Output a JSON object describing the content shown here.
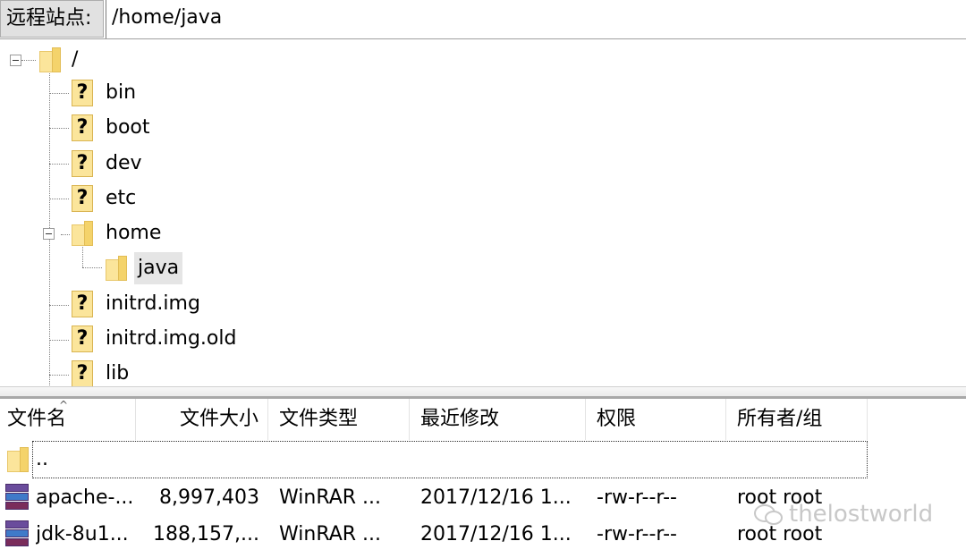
{
  "address_bar": {
    "label": "远程站点:",
    "path": "/home/java"
  },
  "tree": {
    "root": "/",
    "items": [
      {
        "name": "bin",
        "icon": "unknown-folder-icon"
      },
      {
        "name": "boot",
        "icon": "unknown-folder-icon"
      },
      {
        "name": "dev",
        "icon": "unknown-folder-icon"
      },
      {
        "name": "etc",
        "icon": "unknown-folder-icon"
      },
      {
        "name": "home",
        "icon": "folder-icon",
        "expanded": true
      },
      {
        "name": "java",
        "icon": "folder-icon",
        "selected": true
      },
      {
        "name": "initrd.img",
        "icon": "unknown-folder-icon"
      },
      {
        "name": "initrd.img.old",
        "icon": "unknown-folder-icon"
      },
      {
        "name": "lib",
        "icon": "unknown-folder-icon"
      }
    ],
    "unknown_glyph": "?"
  },
  "file_list": {
    "columns": [
      "文件名",
      "文件大小",
      "文件类型",
      "最近修改",
      "权限",
      "所有者/组"
    ],
    "sort_indicator": "^",
    "parent_row": "..",
    "rows": [
      {
        "name": "apache-...",
        "size": "8,997,403",
        "type": "WinRAR ...",
        "modified": "2017/12/16 1...",
        "perms": "-rw-r--r--",
        "owner": "root root"
      },
      {
        "name": "jdk-8u1...",
        "size": "188,157,...",
        "type": "WinRAR ...",
        "modified": "2017/12/16 1...",
        "perms": "-rw-r--r--",
        "owner": "root root"
      }
    ]
  },
  "watermark": "thelostworld",
  "colors": {
    "folder": "#fbe59b",
    "folder_flap": "#f4d36b",
    "selection": "#e5e5e5",
    "label_bg": "#e1e1e1"
  }
}
